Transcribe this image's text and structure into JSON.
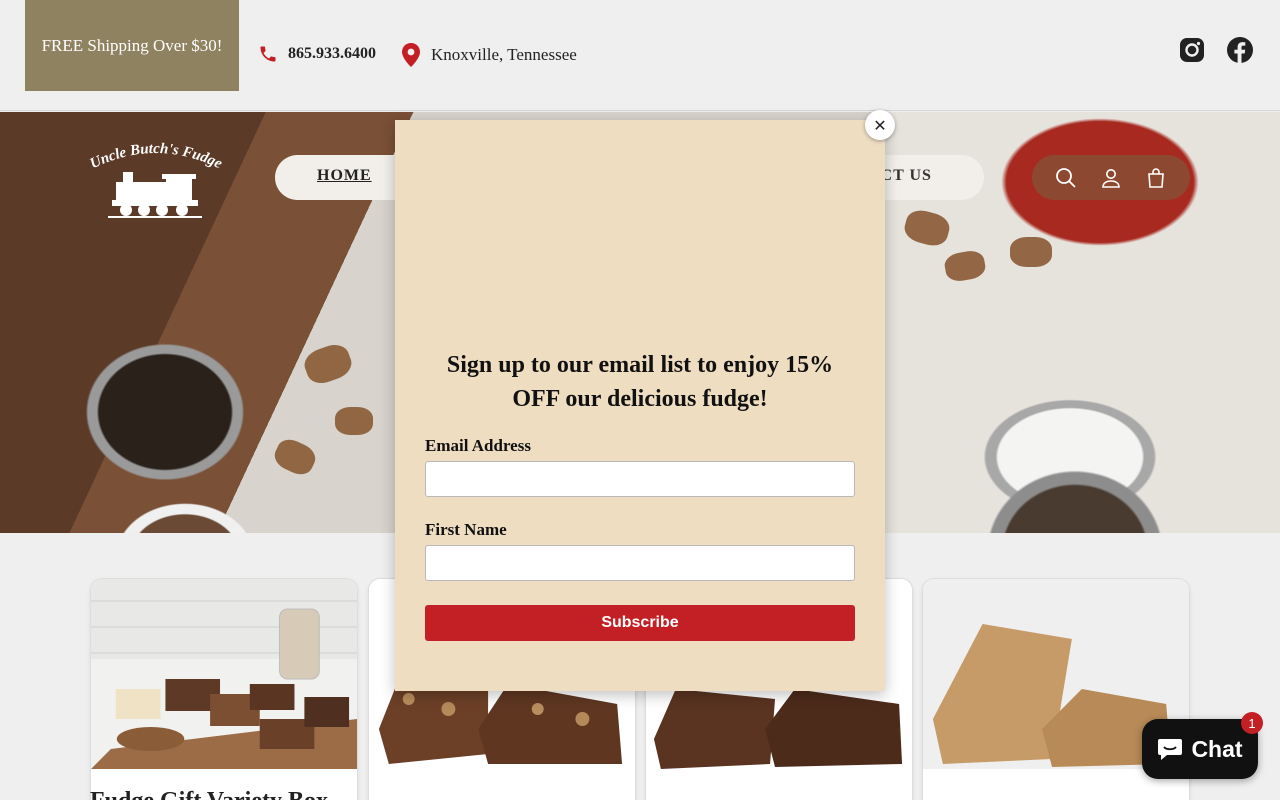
{
  "topbar": {
    "shipping_text": "FREE Shipping Over $30!",
    "phone": "865.933.6400",
    "location": "Knoxville, Tennessee",
    "social_icons": [
      "instagram-icon",
      "facebook-icon"
    ]
  },
  "header": {
    "logo_text": "Uncle Butch's Fudge",
    "nav": [
      {
        "label": "HOME",
        "active": true
      },
      {
        "label": "ACT US",
        "active": false
      }
    ],
    "icons": [
      "search-icon",
      "account-icon",
      "cart-icon"
    ]
  },
  "products": {
    "first_title": "Fudge Gift Variety Box"
  },
  "popup": {
    "heading": "Sign up to our email list to enjoy 15% OFF our delicious fudge!",
    "email_label": "Email Address",
    "email_value": "",
    "first_name_label": "First Name",
    "first_name_value": "",
    "subscribe_label": "Subscribe",
    "close_label": "✕"
  },
  "chat": {
    "label": "Chat",
    "badge_count": "1"
  },
  "colors": {
    "brand_tan": "#8f8261",
    "popup_bg": "#efddc2",
    "subscribe_red": "#c32026",
    "phone_red": "#c32026"
  }
}
